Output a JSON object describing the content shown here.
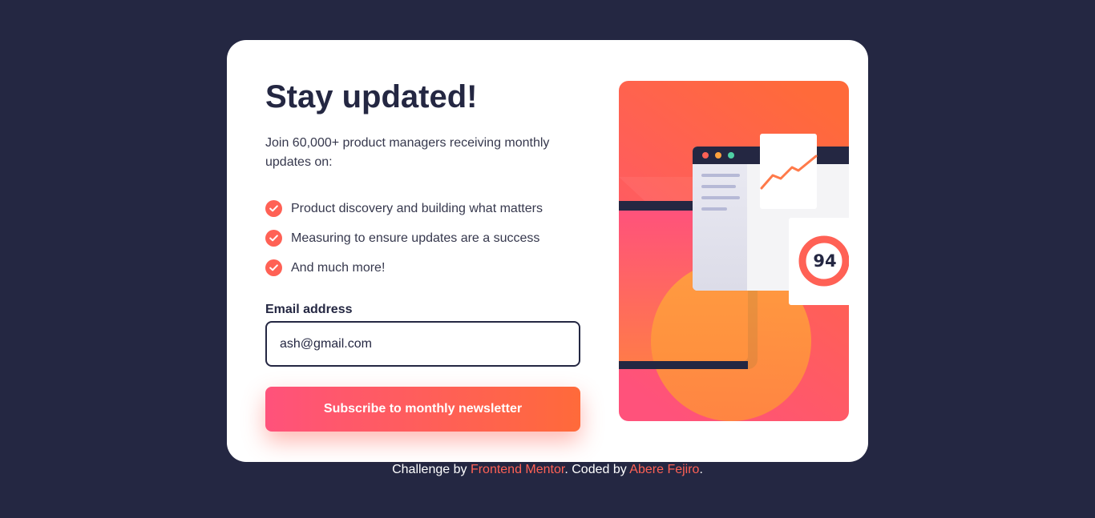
{
  "signup": {
    "title": "Stay updated!",
    "intro": "Join 60,000+ product managers receiving monthly updates on:",
    "features": [
      {
        "icon": "check-icon",
        "text": "Product discovery and building what matters"
      },
      {
        "icon": "check-icon",
        "text": "Measuring to ensure updates are a success"
      },
      {
        "icon": "check-icon",
        "text": "And much more!"
      }
    ],
    "email_label": "Email address",
    "email_value": "ash@gmail.com",
    "button_label": "Subscribe to monthly newsletter"
  },
  "illustration": {
    "score": "94"
  },
  "footer": {
    "prefix": "Challenge by ",
    "link1": "Frontend Mentor",
    "middle": ". Coded by ",
    "link2": "Abere Fejiro",
    "suffix": "."
  },
  "colors": {
    "background": "#242742",
    "card": "#ffffff",
    "accent": "#ff6155",
    "text_dark": "#242742",
    "text_body": "#36384d",
    "gradient_pink": "#ff527b",
    "gradient_orange": "#ff6a3a"
  }
}
